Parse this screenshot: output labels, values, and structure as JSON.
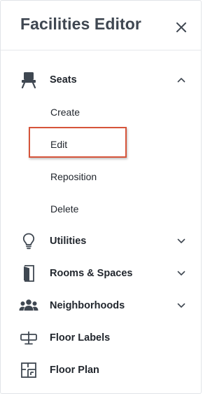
{
  "panel": {
    "title": "Facilities Editor",
    "close_icon": "close-icon"
  },
  "menu": {
    "seats": {
      "label": "Seats",
      "icon": "chair-icon",
      "expanded": true,
      "chevron": "chevron-up-icon",
      "items": [
        {
          "label": "Create"
        },
        {
          "label": "Edit",
          "highlighted": true
        },
        {
          "label": "Reposition"
        },
        {
          "label": "Delete"
        }
      ]
    },
    "utilities": {
      "label": "Utilities",
      "icon": "lightbulb-icon",
      "chevron": "chevron-down-icon"
    },
    "rooms": {
      "label": "Rooms & Spaces",
      "icon": "door-icon",
      "chevron": "chevron-down-icon"
    },
    "neighborhoods": {
      "label": "Neighborhoods",
      "icon": "people-group-icon",
      "chevron": "chevron-down-icon"
    },
    "floor_labels": {
      "label": "Floor Labels",
      "icon": "sign-icon"
    },
    "floor_plan": {
      "label": "Floor Plan",
      "icon": "floor-plan-icon"
    }
  },
  "colors": {
    "highlight_border": "#d6543a",
    "icon_color": "#3f4751",
    "title_color": "#3f4751"
  }
}
